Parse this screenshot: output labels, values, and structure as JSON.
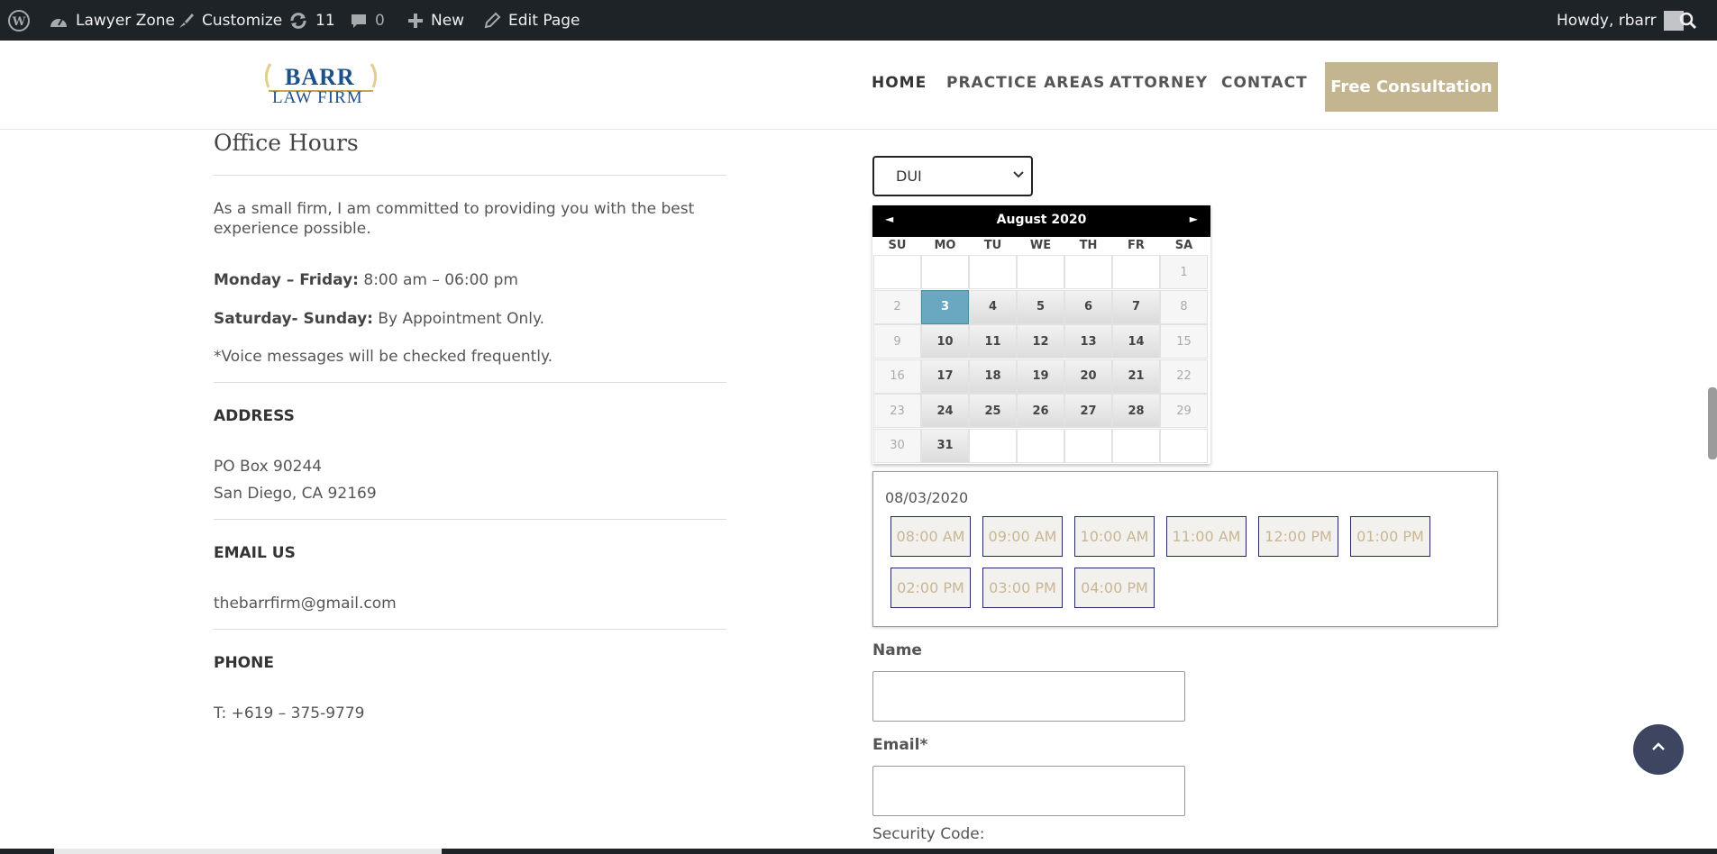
{
  "adminbar": {
    "site_name": "Lawyer Zone",
    "customize": "Customize",
    "updates_count": "11",
    "comments_count": "0",
    "new_label": "New",
    "edit_page": "Edit Page",
    "howdy": "Howdy, rbarr"
  },
  "header": {
    "logo_line1": "BARR",
    "logo_line2": "LAW FIRM",
    "nav": [
      "HOME",
      "PRACTICE AREAS",
      "ATTORNEY",
      "CONTACT"
    ],
    "cta": "Free Consultation"
  },
  "left": {
    "office_hours_title": "Office Hours",
    "intro": "As a small firm, I am committed to providing you with the best experience possible.",
    "weekday_label": "Monday – Friday:",
    "weekday_hours": " 8:00 am – 06:00 pm",
    "weekend_label": "Saturday- Sunday:",
    "weekend_hours": " By Appointment Only.",
    "voice_note": "*Voice messages will be checked frequently.",
    "address_label": "ADDRESS",
    "address_line1": "PO Box 90244",
    "address_line2": "San Diego, CA 92169",
    "email_label": "EMAIL US",
    "email": "thebarrfirm@gmail.com",
    "phone_label": "PHONE",
    "phone": "T: +619 – 375-9779"
  },
  "booking": {
    "service_selected": "DUI",
    "calendar": {
      "title": "August 2020",
      "prev": "◄",
      "next": "►",
      "dow": [
        "SU",
        "MO",
        "TU",
        "WE",
        "TH",
        "FR",
        "SA"
      ],
      "weeks": [
        [
          "",
          "",
          "",
          "",
          "",
          "",
          "1"
        ],
        [
          "2",
          "3",
          "4",
          "5",
          "6",
          "7",
          "8"
        ],
        [
          "9",
          "10",
          "11",
          "12",
          "13",
          "14",
          "15"
        ],
        [
          "16",
          "17",
          "18",
          "19",
          "20",
          "21",
          "22"
        ],
        [
          "23",
          "24",
          "25",
          "26",
          "27",
          "28",
          "29"
        ],
        [
          "30",
          "31",
          "",
          "",
          "",
          "",
          ""
        ]
      ],
      "selected_day": "3"
    },
    "selected_date": "08/03/2020",
    "time_slots": [
      "08:00 AM",
      "09:00 AM",
      "10:00 AM",
      "11:00 AM",
      "12:00 PM",
      "01:00 PM",
      "02:00 PM",
      "03:00 PM",
      "04:00 PM"
    ],
    "name_label": "Name",
    "email_label": "Email*",
    "security_label": "Security Code:"
  },
  "colors": {
    "admin_bar": "#1d2327",
    "cta_bg": "#c3b590",
    "selected_day": "#6aa8c1",
    "slot_border": "#1f2a6b",
    "slot_text": "#c8b694",
    "to_top": "#3d4560"
  },
  "icons": [
    "wordpress-icon",
    "dashboard-icon",
    "brush-icon",
    "updates-icon",
    "comment-icon",
    "plus-icon",
    "pencil-icon",
    "avatar-icon",
    "search-icon",
    "chevron-down-icon",
    "chevron-up-icon"
  ]
}
